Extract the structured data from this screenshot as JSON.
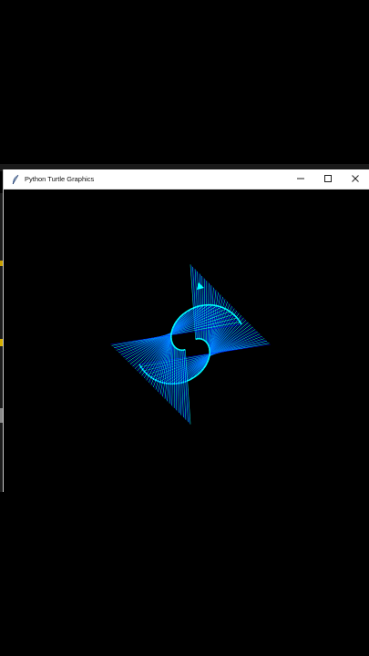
{
  "window": {
    "title": "Python Turtle Graphics"
  },
  "icons": {
    "app": "feather-icon",
    "minimize": "minimize-icon",
    "maximize": "maximize-icon",
    "close": "close-icon"
  },
  "drawing": {
    "background_color": "#000000",
    "line_colors": [
      "#00ffff",
      "#0000ff"
    ],
    "turtle_color": "#00ffff"
  }
}
